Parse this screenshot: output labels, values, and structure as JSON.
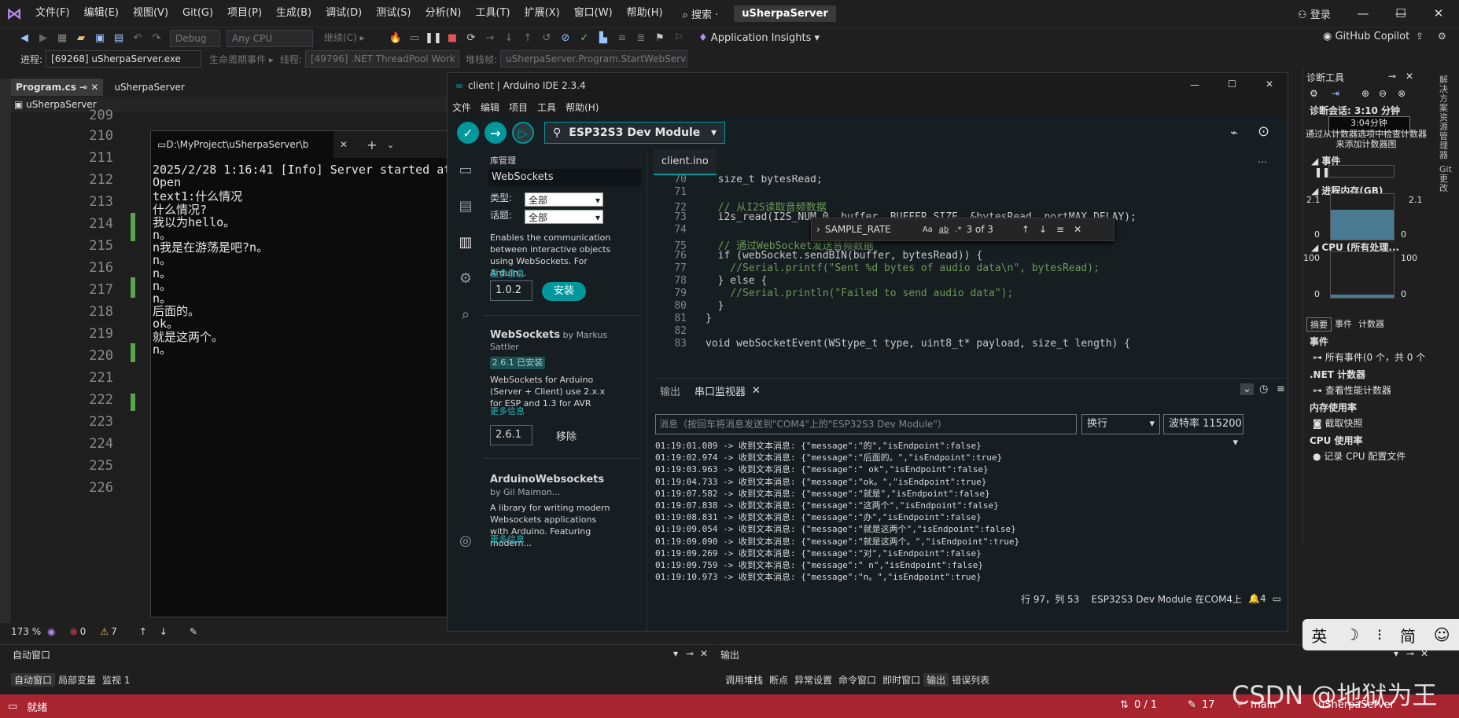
{
  "vs": {
    "menu": [
      "文件(F)",
      "编辑(E)",
      "视图(V)",
      "Git(G)",
      "项目(P)",
      "生成(B)",
      "调试(D)",
      "测试(S)",
      "分析(N)",
      "工具(T)",
      "扩展(X)",
      "窗口(W)",
      "帮助(H)"
    ],
    "search": "搜索 ·",
    "solution": "uSherpaServer",
    "login": "登录",
    "config": "Debug",
    "platform": "Any CPU",
    "continue": "继续(C) ▸",
    "app_insights": "Application Insights",
    "copilot": "GitHub Copilot",
    "process_label": "进程:",
    "process": "[69268] uSherpaServer.exe",
    "lifecycle": "生命周期事件 ▸",
    "thread_label": "线程:",
    "thread": "[49796] .NET ThreadPool Work",
    "stack_label": "堆栈帧:",
    "stack": "uSherpaServer.Program.StartWebServ",
    "tabs": [
      "Program.cs",
      "uSherpaServer"
    ],
    "nav": "uSherpaServer",
    "line_numbers": [
      "209",
      "210",
      "211",
      "212",
      "213",
      "214",
      "215",
      "216",
      "217",
      "218",
      "219",
      "220",
      "221",
      "222",
      "223",
      "224",
      "225",
      "226"
    ],
    "zoom": "173 %",
    "errors": "0",
    "warnings": "7",
    "auto_title": "自动窗口",
    "auto_tabs": [
      "自动窗口",
      "局部变量",
      "监视 1"
    ],
    "out_title": "输出",
    "out_tabs": [
      "调用堆栈",
      "断点",
      "异常设置",
      "命令窗口",
      "即时窗口",
      "输出",
      "错误列表"
    ],
    "status": {
      "ready": "就绪",
      "lines": "0 / 1",
      "pen": "17",
      "branch": "main",
      "repo": "uSherpaServer"
    }
  },
  "console": {
    "tab": "D:\\MyProject\\uSherpaServer\\b",
    "lines": [
      "2025/2/28 1:16:41 [Info] Server started at",
      "Open",
      "text1:什么情况",
      "什么情况?",
      "我以为hello。",
      "n。",
      "n我是在游荡是吧?n。",
      "n。",
      "n。",
      "n。",
      "n。",
      "后面的。",
      "ok。",
      "就是这两个。",
      "n。",
      ""
    ]
  },
  "arduino": {
    "title": "client | Arduino IDE 2.3.4",
    "menu": [
      "文件",
      "编辑",
      "项目",
      "工具",
      "帮助(H)"
    ],
    "board": "ESP32S3 Dev Module",
    "lib": {
      "title": "库管理",
      "search": "WebSockets",
      "type_label": "类型:",
      "type": "全部",
      "topic_label": "话题:",
      "topic": "全部",
      "desc1": "Enables the communication between interactive objects using WebSockets. For Arduin...",
      "more": "更多信息",
      "ver1": "1.0.2",
      "install": "安装",
      "name2": "WebSockets",
      "by2": "by Markus Sattler",
      "installed2": "2.6.1 已安装",
      "desc2": "WebSockets for Arduino (Server + Client) use 2.x.x for ESP and 1.3 for AVR",
      "ver2": "2.6.1",
      "remove": "移除",
      "name3": "ArduinoWebsockets",
      "by3": "by Gil Maimon...",
      "desc3": "A library for writing modern Websockets applications with Arduino. Featuring modern..."
    },
    "file_tab": "client.ino",
    "find": {
      "query": "SAMPLE_RATE",
      "count": "3 of 3"
    },
    "code": [
      {
        "n": "70",
        "t": "  size_t bytesRead;"
      },
      {
        "n": "71",
        "t": ""
      },
      {
        "n": "72",
        "t": "  // 从I2S读取音频数据"
      },
      {
        "n": "73",
        "t": "  i2s_read(I2S_NUM_0, buffer, BUFFER_SIZE, &bytesRead, portMAX_DELAY);"
      },
      {
        "n": "74",
        "t": ""
      },
      {
        "n": "75",
        "t": "  // 通过WebSocket发送音频数据"
      },
      {
        "n": "76",
        "t": "  if (webSocket.sendBIN(buffer, bytesRead)) {"
      },
      {
        "n": "77",
        "t": "    //Serial.printf(\"Sent %d bytes of audio data\\n\", bytesRead);"
      },
      {
        "n": "78",
        "t": "  } else {"
      },
      {
        "n": "79",
        "t": "    //Serial.println(\"Failed to send audio data\");"
      },
      {
        "n": "80",
        "t": "  }"
      },
      {
        "n": "81",
        "t": "}"
      },
      {
        "n": "82",
        "t": ""
      },
      {
        "n": "83",
        "t": "void webSocketEvent(WStype_t type, uint8_t* payload, size_t length) {"
      }
    ],
    "out_tab": "输出",
    "serial_tab": "串口监视器",
    "serial_placeholder": "消息（按回车将消息发送到\"COM4\"上的\"ESP32S3 Dev Module\"）",
    "line_ending": "换行",
    "baud": "波特率 115200",
    "log": [
      "01:19:01.089 -> 收到文本消息: {\"message\":\"的\",\"isEndpoint\":false}",
      "01:19:02.974 -> 收到文本消息: {\"message\":\"后面的。\",\"isEndpoint\":true}",
      "01:19:03.963 -> 收到文本消息: {\"message\":\" ok\",\"isEndpoint\":false}",
      "01:19:04.733 -> 收到文本消息: {\"message\":\"ok。\",\"isEndpoint\":true}",
      "01:19:07.582 -> 收到文本消息: {\"message\":\"就是\",\"isEndpoint\":false}",
      "01:19:07.838 -> 收到文本消息: {\"message\":\"这两个\",\"isEndpoint\":false}",
      "01:19:08.831 -> 收到文本消息: {\"message\":\"办\",\"isEndpoint\":false}",
      "01:19:09.054 -> 收到文本消息: {\"message\":\"就是这两个\",\"isEndpoint\":false}",
      "01:19:09.090 -> 收到文本消息: {\"message\":\"就是这两个。\",\"isEndpoint\":true}",
      "01:19:09.269 -> 收到文本消息: {\"message\":\"对\",\"isEndpoint\":false}",
      "01:19:09.759 -> 收到文本消息: {\"message\":\" n\",\"isEndpoint\":false}",
      "01:19:10.973 -> 收到文本消息: {\"message\":\"n。\",\"isEndpoint\":true}"
    ],
    "status": "行 97，列 53    ESP32S3 Dev Module 在COM4上",
    "notif": "4"
  },
  "diag": {
    "title": "诊断工具",
    "session": "诊断会话: 3:10 分钟",
    "timeline": "3:04分钟",
    "hint": "通过从计数器选项中检查计数器来添加计数器图",
    "events": "事件",
    "memory": "进程内存(GB)",
    "mem_max": "2.1",
    "mem_min": "0",
    "cpu": "CPU (所有处理...",
    "cpu_max": "100",
    "cpu_min": "0",
    "tabs": [
      "摘要",
      "事件",
      "计数器"
    ],
    "sec_events": "事件",
    "all_events": "所有事件(0 个，共 0 个",
    "sec_net": ".NET 计数器",
    "view_perf": "查看性能计数器",
    "sec_mem": "内存使用率",
    "snapshot": "截取快照",
    "sec_cpu": "CPU 使用率",
    "record_cpu": "记录 CPU 配置文件"
  },
  "ime": [
    "英",
    "☽",
    "⁝",
    "简",
    "☺"
  ],
  "watermark": "CSDN @地狱为王"
}
